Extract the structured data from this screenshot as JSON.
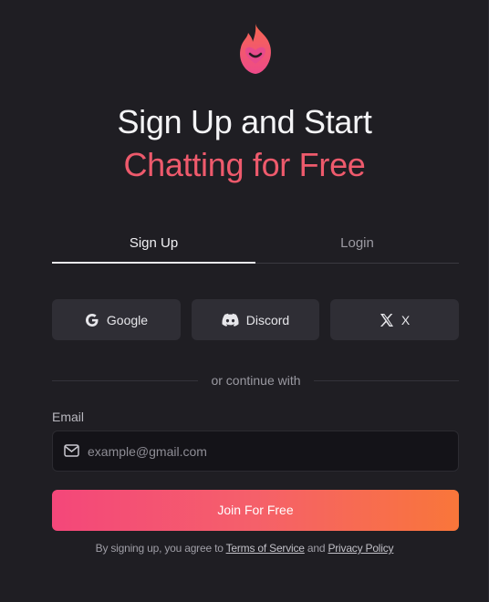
{
  "hero": {
    "title_line1": "Sign Up and Start",
    "title_line2": "Chatting for Free",
    "accent_color": "#ee5a6c"
  },
  "tabs": [
    {
      "label": "Sign Up",
      "active": true
    },
    {
      "label": "Login",
      "active": false
    }
  ],
  "social": {
    "google_label": "Google",
    "discord_label": "Discord",
    "x_label": "X"
  },
  "divider_text": "or continue with",
  "email": {
    "label": "Email",
    "placeholder": "example@gmail.com",
    "value": ""
  },
  "join_button": "Join For Free",
  "terms": {
    "prefix": "By signing up, you agree to",
    "tos": "Terms of Service",
    "and": "and",
    "privacy": "Privacy Policy"
  },
  "icons": [
    "flame-heart-logo",
    "google-icon",
    "discord-icon",
    "x-icon",
    "mail-icon"
  ]
}
